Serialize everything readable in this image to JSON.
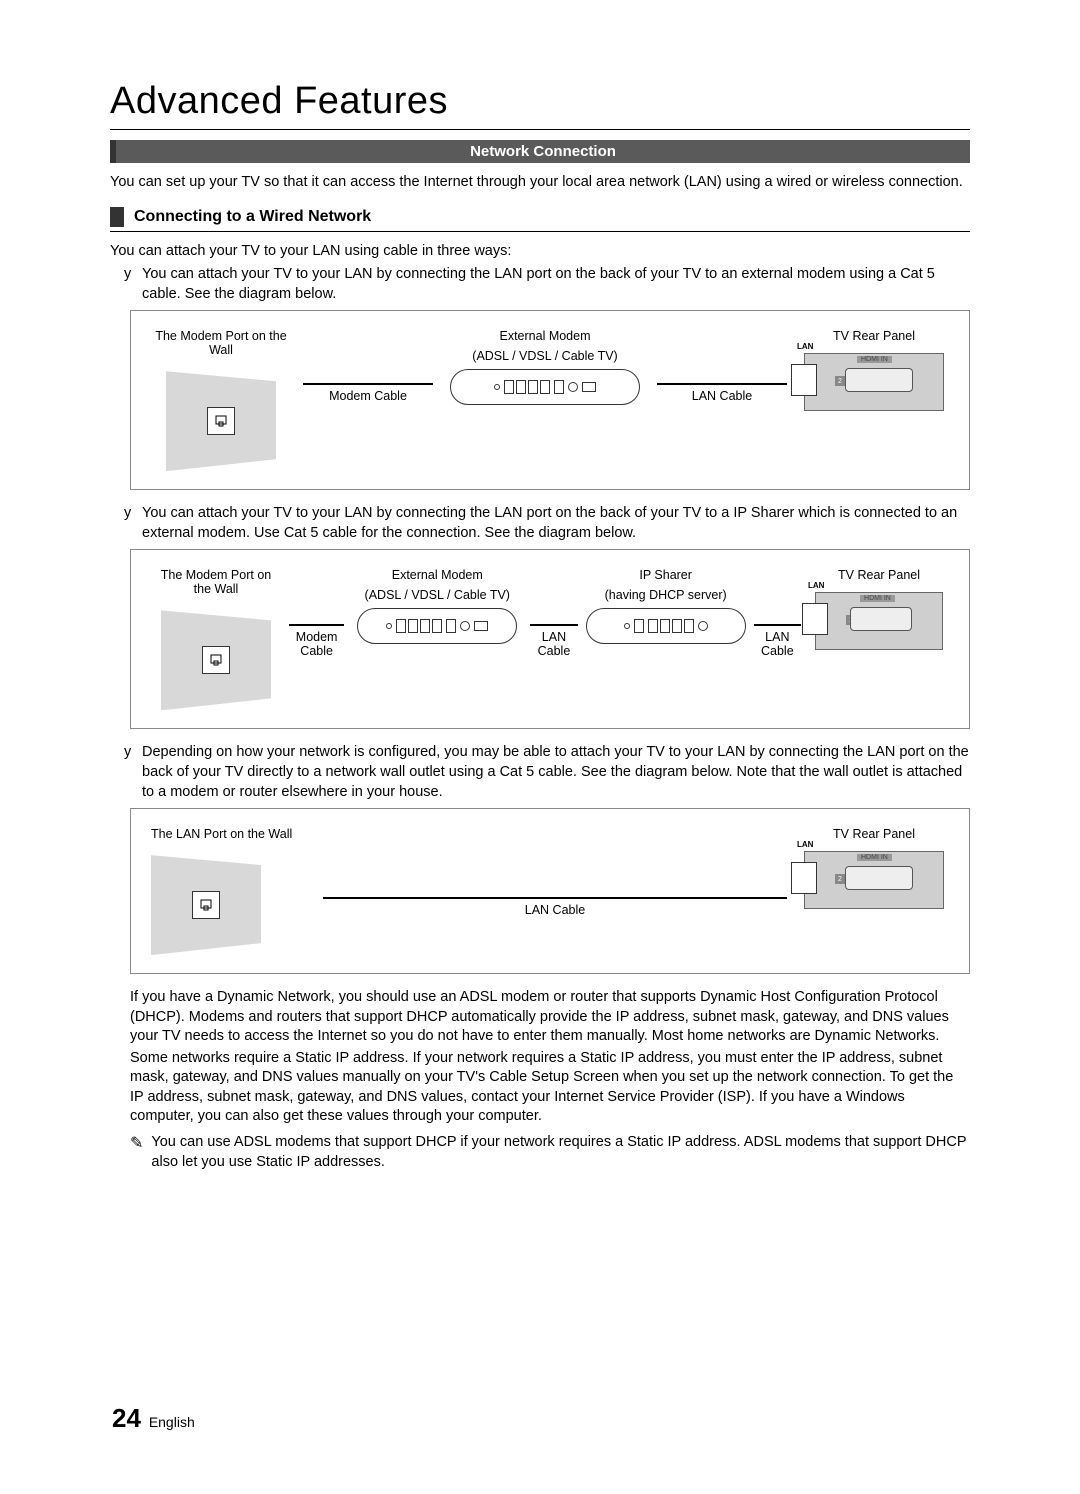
{
  "title": "Advanced Features",
  "band": "Network Connection",
  "intro": "You can set up your TV so that it can access the Internet through your local area network (LAN) using a wired or wireless connection.",
  "sub_heading": "Connecting to a Wired Network",
  "lead": "You can attach your TV to your LAN using cable in three ways:",
  "bullets": {
    "b1": "You can attach your TV to your LAN by connecting the LAN port on the back of your TV to an external modem using a Cat 5 cable. See the diagram below.",
    "b2": "You can attach your TV to your LAN by connecting the LAN port on the back of your TV to a IP Sharer which is connected to an external modem. Use Cat 5 cable for the connection. See the diagram below.",
    "b3": "Depending on how your network is configured, you may be able to attach your TV to your LAN by connecting the LAN port on the back of your TV directly to a network wall outlet using a Cat 5 cable. See the diagram below. Note that the wall outlet is attached to a modem or router elsewhere in your house."
  },
  "diagram1": {
    "wall_label": "The Modem Port on the Wall",
    "modem_label_top": "External Modem",
    "modem_label_sub": "(ADSL / VDSL / Cable TV)",
    "tv_label": "TV Rear Panel",
    "cable1": "Modem Cable",
    "cable2": "LAN Cable",
    "lan": "LAN",
    "hdmi": "HDMI IN",
    "port2": "2"
  },
  "diagram2": {
    "wall_label": "The Modem Port on the Wall",
    "modem_label_top": "External Modem",
    "modem_label_sub": "(ADSL / VDSL / Cable TV)",
    "sharer_label_top": "IP Sharer",
    "sharer_label_sub": "(having DHCP server)",
    "tv_label": "TV Rear Panel",
    "cable1": "Modem Cable",
    "cable2": "LAN Cable",
    "cable3": "LAN Cable",
    "lan": "LAN",
    "hdmi": "HDMI IN",
    "port2": "2"
  },
  "diagram3": {
    "wall_label": "The LAN Port on the Wall",
    "tv_label": "TV Rear Panel",
    "cable1": "LAN Cable",
    "lan": "LAN",
    "hdmi": "HDMI IN",
    "port2": "2"
  },
  "para1": "If you have a Dynamic Network, you should use an ADSL modem or router that supports Dynamic Host Configuration Protocol (DHCP). Modems and routers that support DHCP automatically provide the IP address, subnet mask, gateway, and DNS values your TV needs to access the Internet so you do not have to enter them manually. Most home networks are Dynamic Networks.",
  "para2": "Some networks require a Static IP address. If your network requires a Static IP address, you must enter the IP address, subnet mask, gateway, and DNS values manually on your TV's Cable Setup Screen when you set up the network connection. To get the IP address, subnet mask, gateway, and DNS values, contact your Internet Service Provider (ISP). If you have a Windows computer, you can also get these values through your computer.",
  "note": "You can use ADSL modems that support DHCP if your network requires a Static IP address. ADSL modems that support DHCP also let you use Static IP addresses.",
  "footer": {
    "page": "24",
    "lang": "English"
  }
}
